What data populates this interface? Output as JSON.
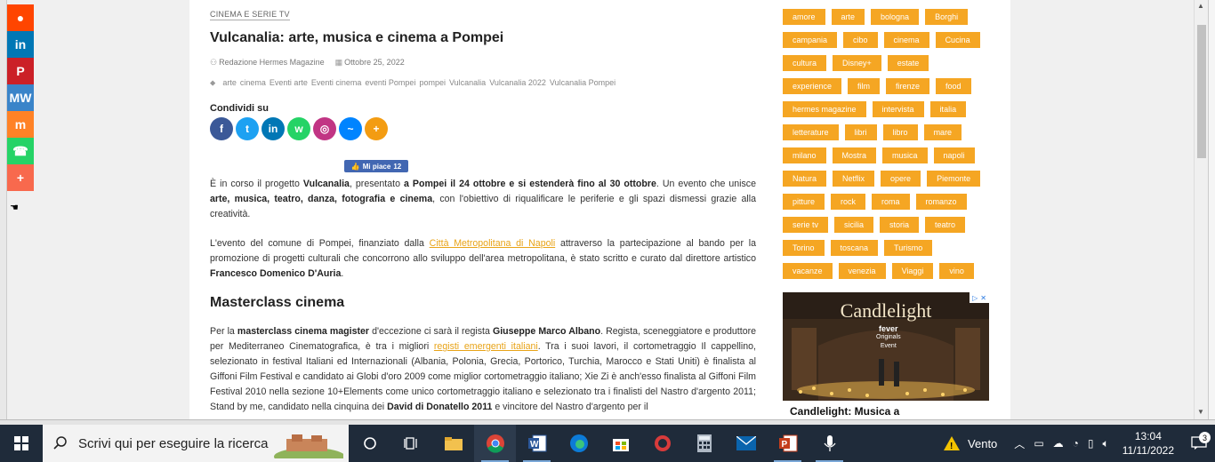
{
  "share_bar": {
    "items": [
      {
        "name": "reddit",
        "color": "#ff4500",
        "glyph": "●"
      },
      {
        "name": "linkedin",
        "color": "#0077b5",
        "glyph": "in"
      },
      {
        "name": "pinterest",
        "color": "#cb2027",
        "glyph": "P"
      },
      {
        "name": "meneame",
        "color": "#3a84c9",
        "glyph": "MW"
      },
      {
        "name": "mix",
        "color": "#ff8226",
        "glyph": "m"
      },
      {
        "name": "whatsapp",
        "color": "#25d366",
        "glyph": "☎"
      },
      {
        "name": "more",
        "color": "#f8694d",
        "glyph": "+"
      }
    ]
  },
  "article": {
    "category": "CINEMA E SERIE TV",
    "title": "Vulcanalia: arte, musica e cinema a Pompei",
    "author": "Redazione Hermes Magazine",
    "date": "Ottobre 25, 2022",
    "tags": [
      "arte",
      "cinema",
      "Eventi arte",
      "Eventi cinema",
      "eventi Pompei",
      "pompei",
      "Vulcanalia",
      "Vulcanalia 2022",
      "Vulcanalia Pompei"
    ],
    "share_label": "Condividi su",
    "share_icons": [
      {
        "name": "facebook",
        "color": "#3b5998",
        "glyph": "f"
      },
      {
        "name": "twitter",
        "color": "#1da1f2",
        "glyph": "t"
      },
      {
        "name": "linkedin",
        "color": "#0077b5",
        "glyph": "in"
      },
      {
        "name": "whatsapp",
        "color": "#25d366",
        "glyph": "w"
      },
      {
        "name": "instagram",
        "color": "#c13584",
        "glyph": "◎"
      },
      {
        "name": "messenger",
        "color": "#0084ff",
        "glyph": "~"
      },
      {
        "name": "more",
        "color": "#f39c12",
        "glyph": "+"
      }
    ],
    "like_button": {
      "label": "Mi piace",
      "count": "12"
    },
    "heading": "Masterclass cinema"
  },
  "sidebar": {
    "tag_rows": [
      [
        "amore",
        "arte",
        "bologna",
        "Borghi"
      ],
      [
        "campania",
        "cibo",
        "cinema",
        "Cucina"
      ],
      [
        "cultura",
        "Disney+",
        "estate"
      ],
      [
        "experience",
        "film",
        "firenze",
        "food"
      ],
      [
        "hermes magazine",
        "intervista",
        "italia"
      ],
      [
        "letterature",
        "libri",
        "libro",
        "mare"
      ],
      [
        "milano",
        "Mostra",
        "musica",
        "napoli"
      ],
      [
        "Natura",
        "Netflix",
        "opere",
        "Piemonte"
      ],
      [
        "pitture",
        "rock",
        "roma",
        "romanzo"
      ],
      [
        "serie tv",
        "sicilia",
        "storia",
        "teatro"
      ],
      [
        "Torino",
        "toscana",
        "Turismo"
      ],
      [
        "vacanze",
        "venezia",
        "Viaggi",
        "vino"
      ]
    ],
    "tag_color": "#f5a623",
    "ad": {
      "title": "Candlelight",
      "brand_line1": "fever",
      "brand_line2": "Originals",
      "brand_line3": "Event",
      "caption": "Candlelight: Musica a"
    }
  },
  "taskbar": {
    "search_placeholder": "Scrivi qui per eseguire la ricerca",
    "weather": "Vento",
    "time": "13:04",
    "date": "11/11/2022",
    "notifications": "3"
  }
}
